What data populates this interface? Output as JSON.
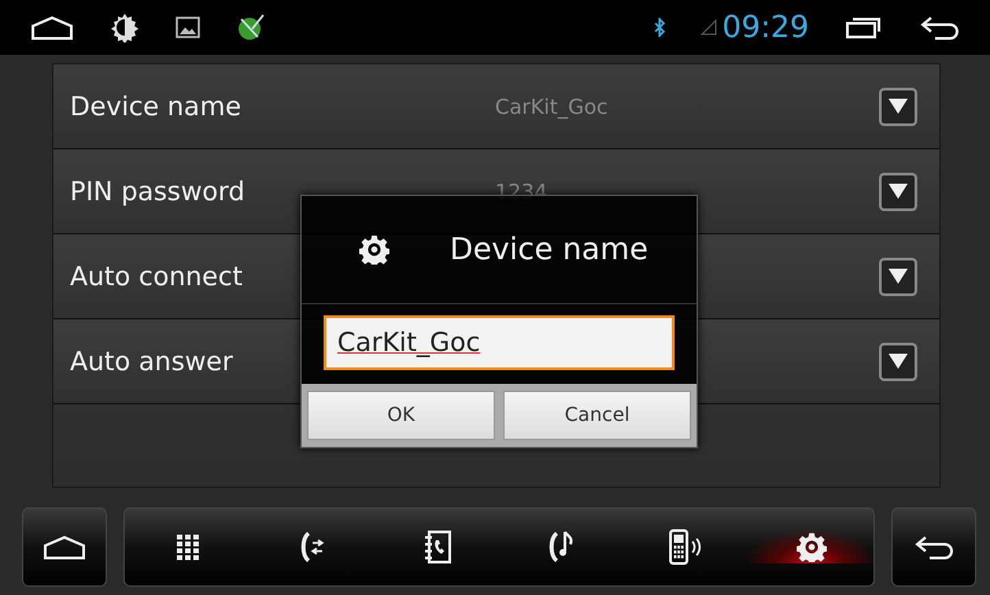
{
  "status_bar": {
    "time": "09:29"
  },
  "settings": [
    {
      "label": "Device name",
      "value": "CarKit_Goc"
    },
    {
      "label": "PIN password",
      "value": "1234"
    },
    {
      "label": "Auto connect"
    },
    {
      "label": "Auto answer"
    }
  ],
  "dialog": {
    "title": "Device name",
    "input_value": "CarKit_Goc",
    "buttons": [
      "OK",
      "Cancel"
    ]
  },
  "dock": [
    {
      "kind": "dialpad",
      "selected": false
    },
    {
      "kind": "call-log",
      "selected": false
    },
    {
      "kind": "contacts",
      "selected": false
    },
    {
      "kind": "music",
      "selected": false
    },
    {
      "kind": "phone",
      "selected": false
    },
    {
      "kind": "settings",
      "selected": true
    }
  ]
}
